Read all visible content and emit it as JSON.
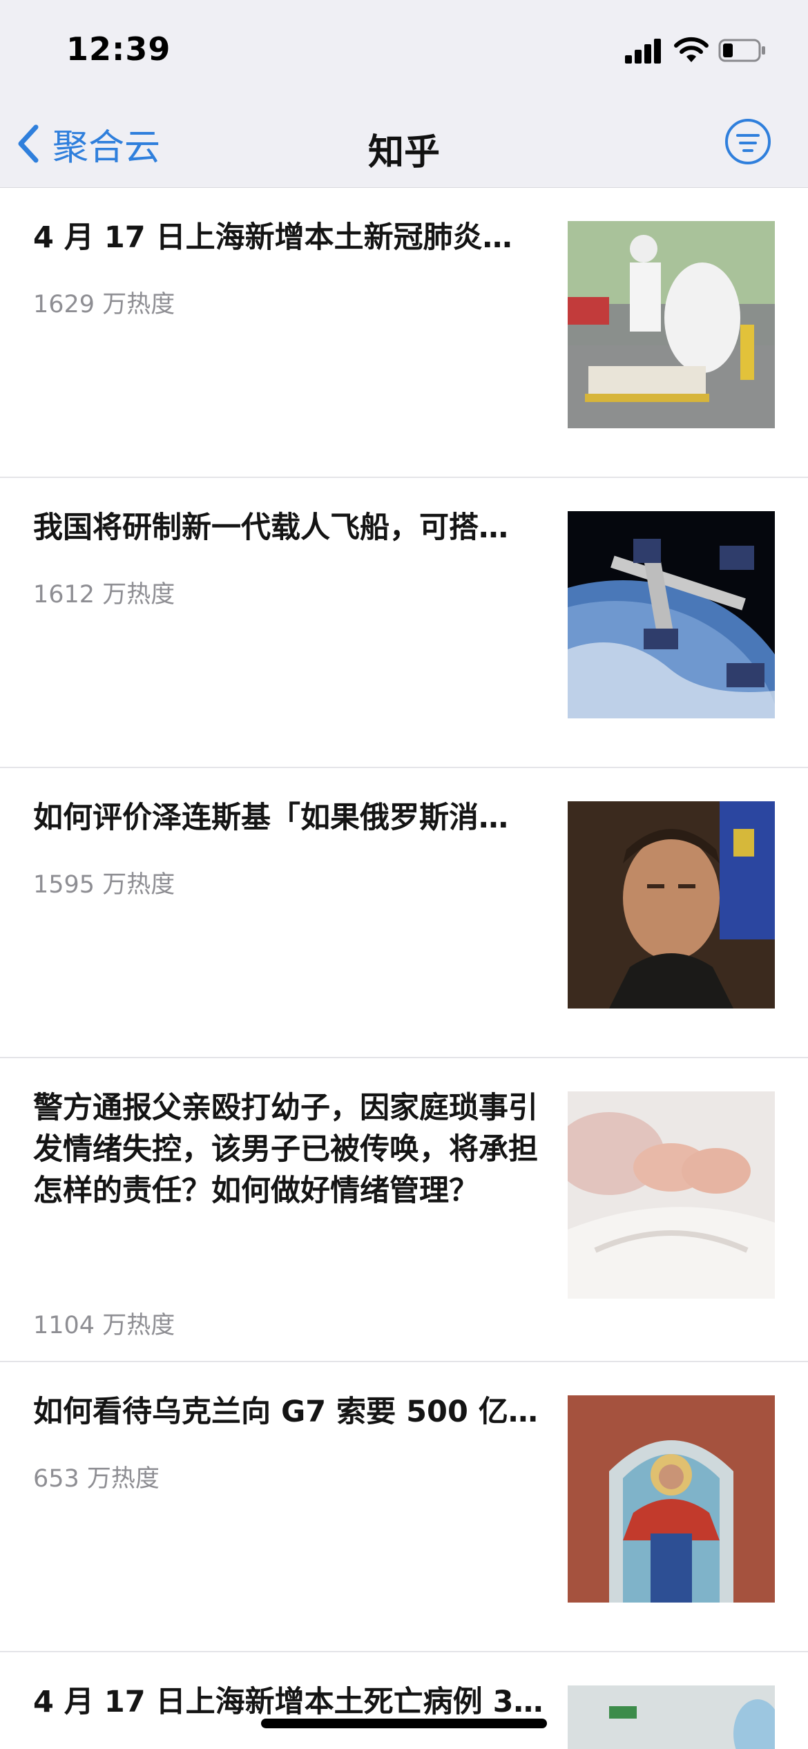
{
  "status_bar": {
    "time": "12:39",
    "icons": [
      "cellular-signal-icon",
      "wifi-icon",
      "battery-icon"
    ]
  },
  "nav": {
    "back_label": "聚合云",
    "title": "知乎",
    "filter_icon": "filter-list-icon"
  },
  "colors": {
    "accent": "#2f7fdc",
    "muted_text": "#8e8e93",
    "nav_bg": "#efeff4"
  },
  "items": [
    {
      "title": "4 月 17 日上海新增本土新冠肺炎…",
      "heat": "1629 万热度",
      "image": "medical-worker-photo"
    },
    {
      "title": "我国将研制新一代载人飞船，可搭…",
      "heat": "1612 万热度",
      "image": "space-station-photo"
    },
    {
      "title": "如何评价泽连斯基「如果俄罗斯消…",
      "heat": "1595 万热度",
      "image": "portrait-photo"
    },
    {
      "title": "警方通报父亲殴打幼子，因家庭琐事引发情绪失控，该男子已被传唤，将承担怎样的责任？如何做好情绪管理？",
      "heat": "1104 万热度",
      "image": "baby-feet-photo"
    },
    {
      "title": "如何看待乌克兰向 G7 索要 500 亿…",
      "heat": "653 万热度",
      "image": "church-icon-painting-photo"
    },
    {
      "title": "4 月 17 日上海新增本土死亡病例 3…",
      "heat": "",
      "image": "hospital-photo"
    }
  ]
}
